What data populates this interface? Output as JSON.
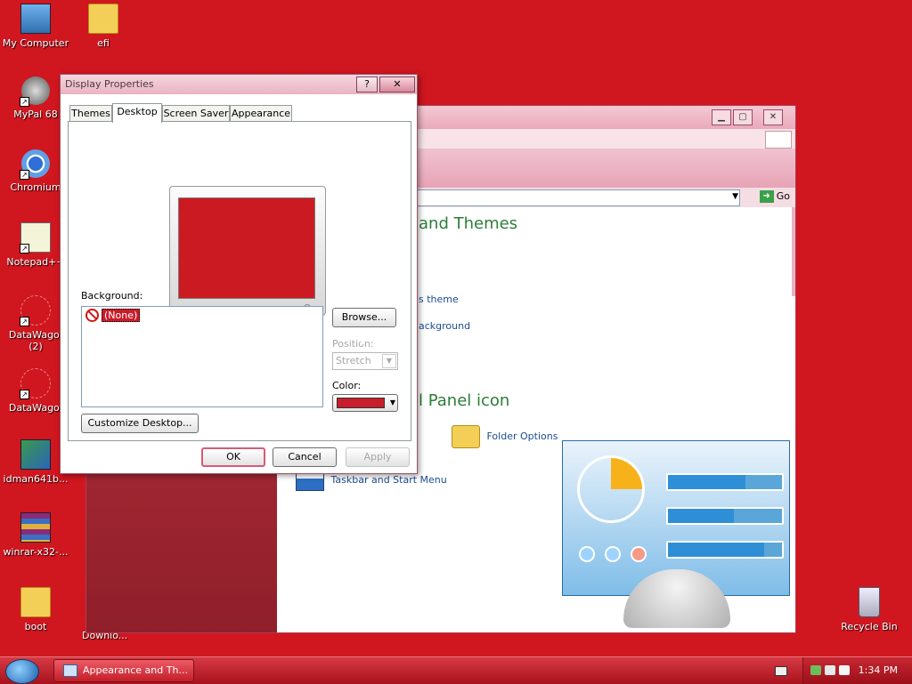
{
  "desktop": {
    "icons": [
      {
        "label": "My Computer"
      },
      {
        "label": "efi"
      },
      {
        "label": "MyPal 68"
      },
      {
        "label": "Chromium"
      },
      {
        "label": "Notepad++"
      },
      {
        "label": "DataWago.\n(2)"
      },
      {
        "label": "DataWago."
      },
      {
        "label": "idman641b..."
      },
      {
        "label": "winrar-x32-..."
      },
      {
        "label": "boot"
      },
      {
        "label": "Recycle Bin"
      }
    ],
    "partial_label": "Downlo..."
  },
  "bg_window": {
    "go_label": "Go",
    "heading1": "and Themes",
    "task1": "s theme",
    "task2": "ackground",
    "heading2": "l Panel icon",
    "icon1_label": "Folder Options",
    "icon2_label": "Taskbar and Start Menu"
  },
  "dialog": {
    "title": "Display Properties",
    "help_label": "?",
    "close_label": "✕",
    "tabs": [
      {
        "label": "Themes"
      },
      {
        "label": "Desktop"
      },
      {
        "label": "Screen Saver"
      },
      {
        "label": "Appearance"
      }
    ],
    "background_label": "Background:",
    "background_items": [
      {
        "label": "(None)"
      }
    ],
    "browse_label": "Browse...",
    "position_label": "Position:",
    "position_value": "Stretch",
    "color_label": "Color:",
    "color_value": "#c81d2a",
    "customize_label": "Customize Desktop...",
    "ok_label": "OK",
    "cancel_label": "Cancel",
    "apply_label": "Apply"
  },
  "taskbar": {
    "task_label": "Appearance and Th...",
    "clock": "1:34 PM"
  }
}
